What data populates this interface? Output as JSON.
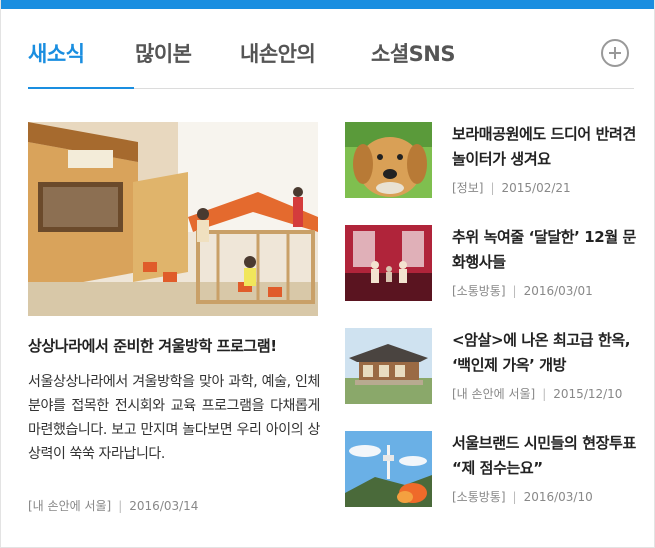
{
  "tabs": [
    {
      "label": "새소식",
      "active": true
    },
    {
      "label": "많이본",
      "active": false
    },
    {
      "label": "내손안의",
      "active": false
    },
    {
      "label": "소셜SNS",
      "active": false
    }
  ],
  "more_icon": "plus-circle-icon",
  "accent_color": "#1a8ee0",
  "feature": {
    "title": "상상나라에서 준비한 겨울방학 프로그램!",
    "description": "서울상상나라에서 겨울방학을 맞아 과학, 예술, 인체 분야를 접목한 전시회와 교육 프로그램을 다채롭게 마련했습니다. 보고 만지며 놀다보면 우리 아이의 상상력이 쑥쑥 자라납니다.",
    "category": "[내 손안에 서울]",
    "separator": "|",
    "date": "2016/03/14"
  },
  "items": [
    {
      "title": "보라매공원에도 드디어 반려견 놀이터가 생겨요",
      "category": "[정보]",
      "separator": "|",
      "date": "2015/02/21"
    },
    {
      "title": "추위 녹여줄 ‘달달한’ 12월 문화행사들",
      "category": "[소통방통]",
      "separator": "|",
      "date": "2016/03/01"
    },
    {
      "title": "<암살>에 나온 최고급 한옥, ‘백인제 가옥’ 개방",
      "category": "[내 손안에 서울]",
      "separator": "|",
      "date": "2015/12/10"
    },
    {
      "title": "서울브랜드 시민들의 현장투표 “제 점수는요”",
      "category": "[소통방통]",
      "separator": "|",
      "date": "2016/03/10"
    }
  ]
}
